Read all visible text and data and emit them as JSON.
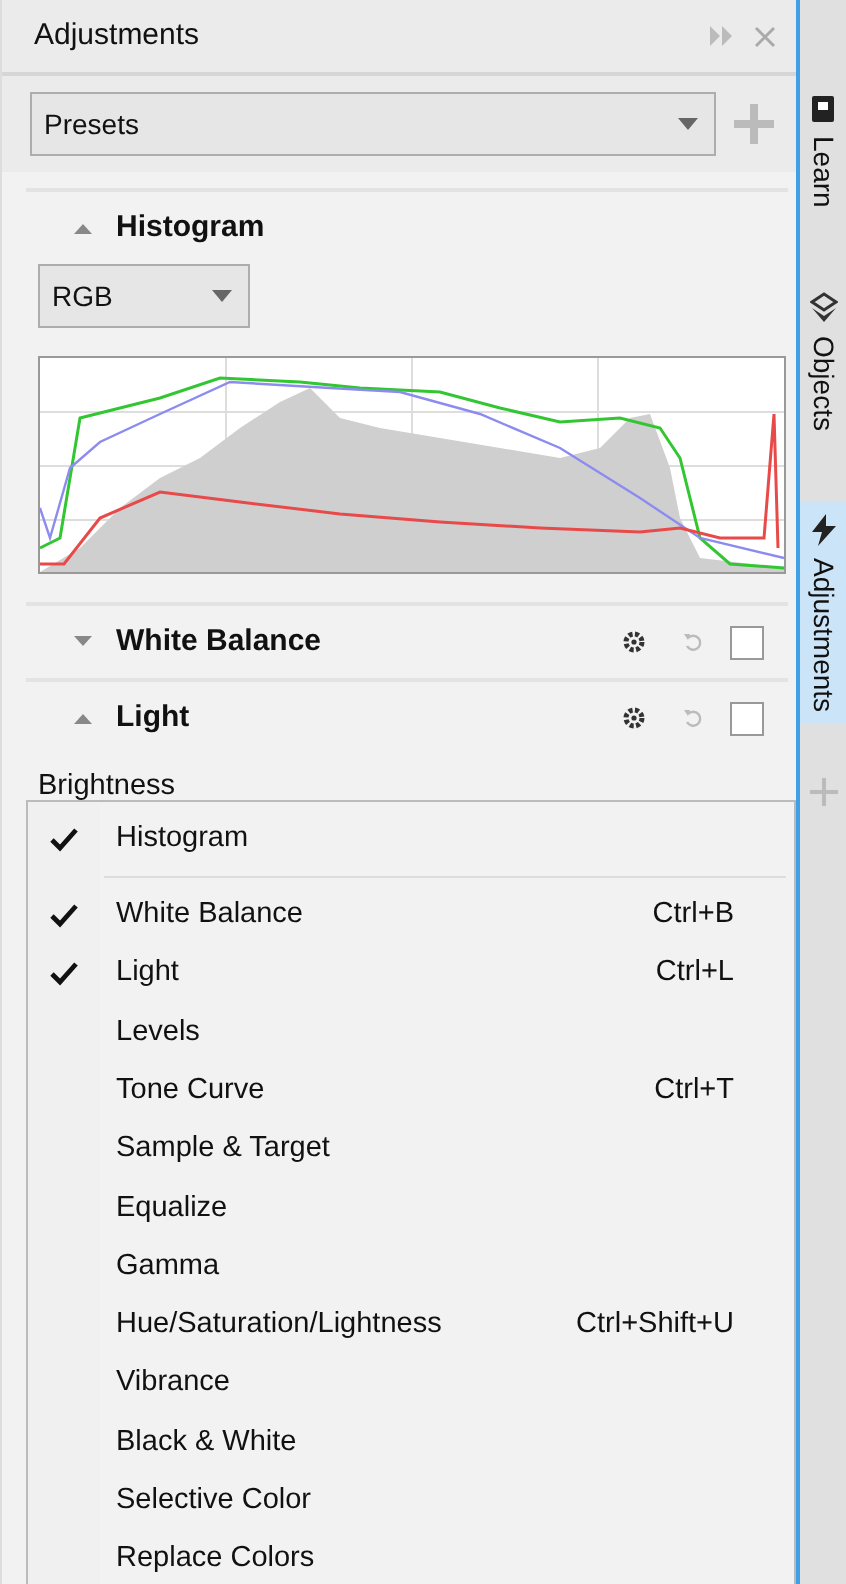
{
  "panel": {
    "title": "Adjustments",
    "presets": {
      "value": "Presets"
    }
  },
  "histogram": {
    "title": "Histogram",
    "expanded": true,
    "channel": {
      "value": "RGB"
    }
  },
  "sections": [
    {
      "title": "White Balance",
      "expanded": false,
      "checked": false
    },
    {
      "title": "Light",
      "expanded": true,
      "checked": false
    }
  ],
  "light_label": "Brightness",
  "side_tabs": [
    {
      "label": "Learn",
      "selected": false
    },
    {
      "label": "Objects",
      "selected": false
    },
    {
      "label": "Adjustments",
      "selected": true
    }
  ],
  "menu": {
    "groups": [
      [
        {
          "label": "Histogram",
          "checked": true
        }
      ],
      [
        {
          "label": "White Balance",
          "shortcut": "Ctrl+B",
          "checked": true
        },
        {
          "label": "Light",
          "shortcut": "Ctrl+L",
          "checked": true
        },
        {
          "label": "Levels",
          "checked": false
        },
        {
          "label": "Tone Curve",
          "shortcut": "Ctrl+T",
          "checked": false
        },
        {
          "label": "Sample & Target",
          "checked": false
        },
        {
          "label": "Equalize",
          "checked": false
        },
        {
          "label": "Gamma",
          "checked": false
        },
        {
          "label": "Hue/Saturation/Lightness",
          "shortcut": "Ctrl+Shift+U",
          "checked": false
        },
        {
          "label": "Vibrance",
          "checked": false
        },
        {
          "label": "Black & White",
          "checked": false
        },
        {
          "label": "Selective Color",
          "checked": false
        },
        {
          "label": "Replace Colors",
          "checked": false
        }
      ]
    ]
  }
}
